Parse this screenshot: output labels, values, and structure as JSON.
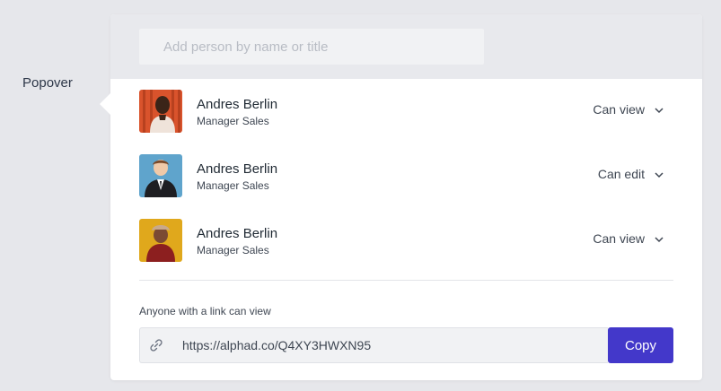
{
  "trigger": {
    "label": "Popover"
  },
  "search": {
    "placeholder": "Add person by name or title"
  },
  "people": [
    {
      "name": "Andres Berlin",
      "title": "Manager Sales",
      "permission": "Can view",
      "avatar_icon": "avatar-portrait-orange"
    },
    {
      "name": "Andres Berlin",
      "title": "Manager Sales",
      "permission": "Can edit",
      "avatar_icon": "avatar-portrait-blue"
    },
    {
      "name": "Andres Berlin",
      "title": "Manager Sales",
      "permission": "Can view",
      "avatar_icon": "avatar-portrait-yellow"
    }
  ],
  "share_link": {
    "note": "Anyone with a link can view",
    "url": "https://alphad.co/Q4XY3HWXN95",
    "copy_label": "Copy",
    "icon": "link-icon"
  },
  "colors": {
    "accent": "#4338ca",
    "background": "#e6e7eb",
    "header": "#e8e9ed"
  }
}
